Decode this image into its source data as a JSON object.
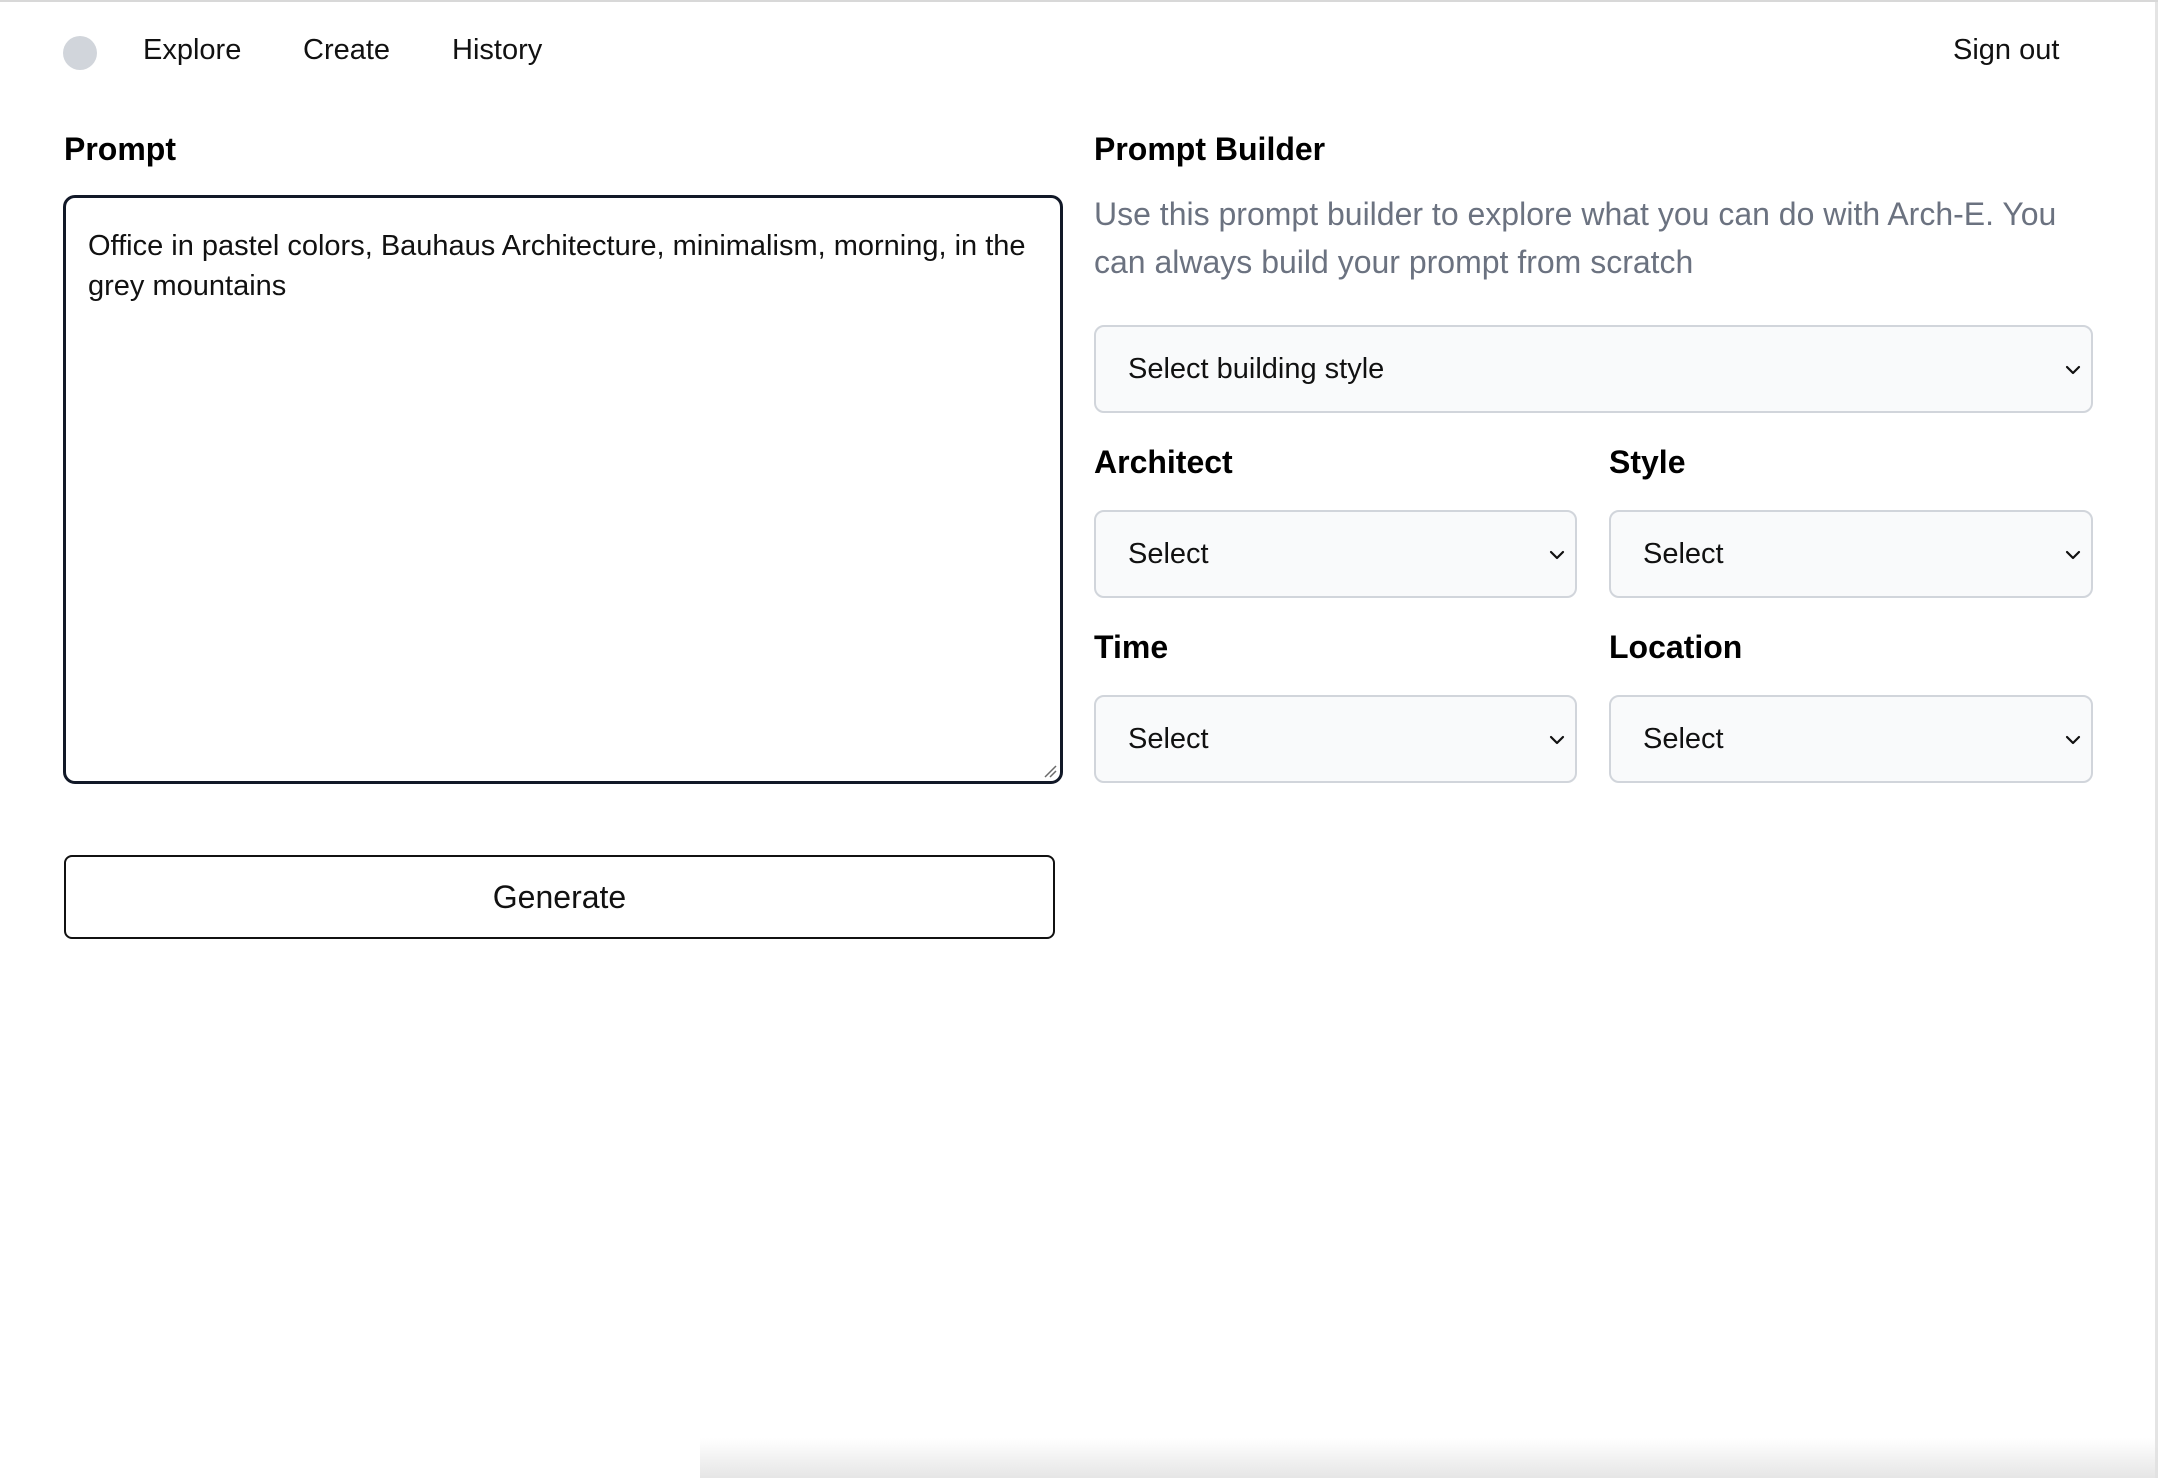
{
  "nav": {
    "links": [
      "Explore",
      "Create",
      "History"
    ],
    "sign_out": "Sign out"
  },
  "prompt": {
    "title": "Prompt",
    "value": "Office in pastel colors, Bauhaus Architecture, minimalism, morning, in the grey mountains",
    "generate_label": "Generate"
  },
  "builder": {
    "title": "Prompt Builder",
    "description": "Use this prompt builder to explore what you can do with Arch-E. You can always build your prompt from scratch",
    "building_style": {
      "value": "Select building style"
    },
    "architect": {
      "label": "Architect",
      "value": "Select"
    },
    "style": {
      "label": "Style",
      "value": "Select"
    },
    "time": {
      "label": "Time",
      "value": "Select"
    },
    "location": {
      "label": "Location",
      "value": "Select"
    }
  },
  "icons": {
    "select_chevron": "chevron-down-icon",
    "logo": "logo-circle",
    "resize": "resize-handle-icon"
  },
  "colors": {
    "description_text": "#6b7280",
    "select_background": "#f9fafb",
    "select_border": "#d1d5db",
    "prompt_border": "#111827",
    "logo": "#d1d5db"
  }
}
